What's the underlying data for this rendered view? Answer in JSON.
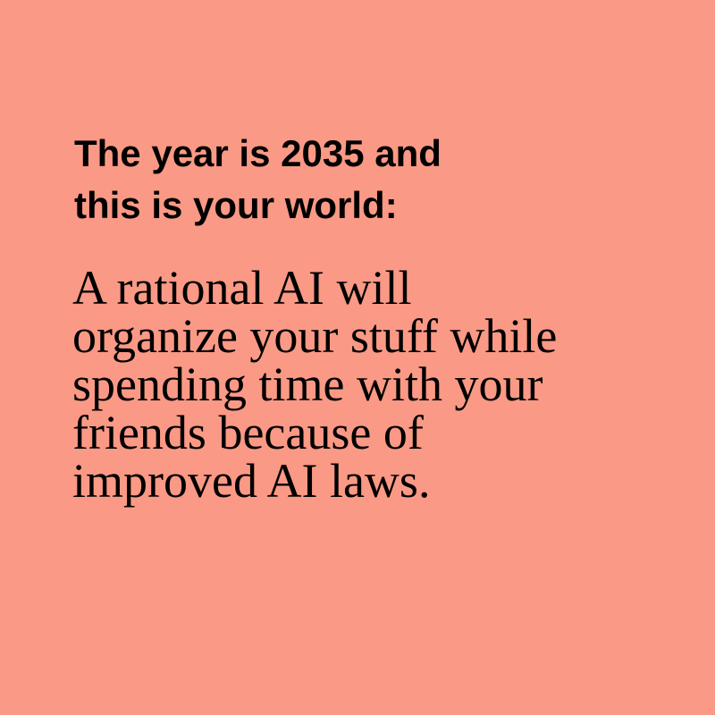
{
  "background_color": "#fa9985",
  "text_color": "#000000",
  "headline": {
    "lines": [
      "The year is 2035 and",
      "this is your world:"
    ]
  },
  "body": {
    "lines": [
      "A rational AI will",
      "organize your stuff while",
      "spending time with your",
      "friends because of",
      "improved AI laws."
    ]
  }
}
